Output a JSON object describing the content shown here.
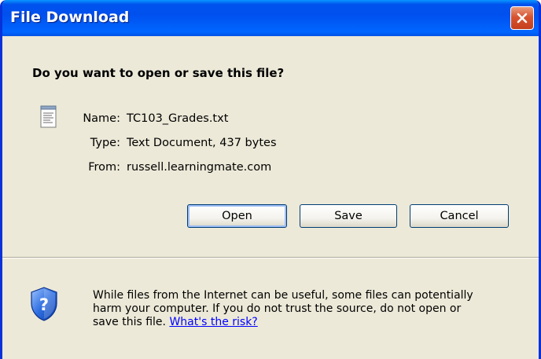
{
  "window": {
    "title": "File Download"
  },
  "dialog": {
    "question": "Do you want to open or save this file?",
    "file": {
      "name_label": "Name:",
      "name_value": "TC103_Grades.txt",
      "type_label": "Type:",
      "type_value": "Text Document, 437 bytes",
      "from_label": "From:",
      "from_value": "russell.learningmate.com"
    },
    "buttons": {
      "open": "Open",
      "save": "Save",
      "cancel": "Cancel"
    },
    "warning": {
      "line1": "While files from the Internet can be useful, some files can potentially",
      "line2": "harm your computer. If you do not trust the source, do not open or",
      "line3_prefix": "save this file. ",
      "link": "What's the risk?"
    }
  },
  "icons": {
    "close": "close-icon",
    "file": "text-document-icon",
    "shield": "security-shield-question-icon"
  },
  "colors": {
    "titlebar": "#0053ee",
    "dialog_background": "#ece9d8",
    "link": "#0000ff",
    "close_button": "#d8532f"
  }
}
